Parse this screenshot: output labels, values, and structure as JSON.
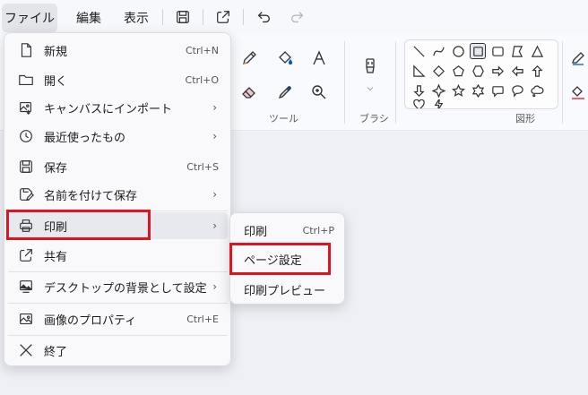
{
  "menubar": {
    "file": "ファイル",
    "edit": "編集",
    "view": "表示"
  },
  "ribbon": {
    "tools_label": "ツール",
    "brush_label": "ブラシ",
    "shapes_label": "図形"
  },
  "file_menu": {
    "items": [
      {
        "label": "新規",
        "shortcut": "Ctrl+N",
        "icon": "new-file-icon"
      },
      {
        "label": "開く",
        "shortcut": "Ctrl+O",
        "icon": "folder-icon"
      },
      {
        "label": "キャンバスにインポート",
        "shortcut": "",
        "icon": "import-image-icon",
        "submenu": true
      },
      {
        "label": "最近使ったもの",
        "shortcut": "",
        "icon": "clock-icon",
        "submenu": true
      },
      {
        "label": "保存",
        "shortcut": "Ctrl+S",
        "icon": "save-icon"
      },
      {
        "label": "名前を付けて保存",
        "shortcut": "",
        "icon": "save-as-icon",
        "submenu": true
      },
      {
        "label": "印刷",
        "shortcut": "",
        "icon": "printer-icon",
        "submenu": true,
        "highlighted": true
      },
      {
        "label": "共有",
        "shortcut": "",
        "icon": "share-icon"
      },
      {
        "label": "デスクトップの背景として設定",
        "shortcut": "",
        "icon": "desktop-background-icon",
        "submenu": true
      },
      {
        "label": "画像のプロパティ",
        "shortcut": "Ctrl+E",
        "icon": "properties-icon"
      },
      {
        "label": "終了",
        "shortcut": "",
        "icon": "close-icon"
      }
    ],
    "chevron": "›"
  },
  "print_submenu": {
    "items": [
      {
        "label": "印刷",
        "shortcut": "Ctrl+P"
      },
      {
        "label": "ページ設定",
        "shortcut": "",
        "highlighted": true
      },
      {
        "label": "印刷プレビュー",
        "shortcut": ""
      }
    ]
  },
  "colors": {
    "highlight": "#e0141e",
    "accent": "#005fb8"
  }
}
